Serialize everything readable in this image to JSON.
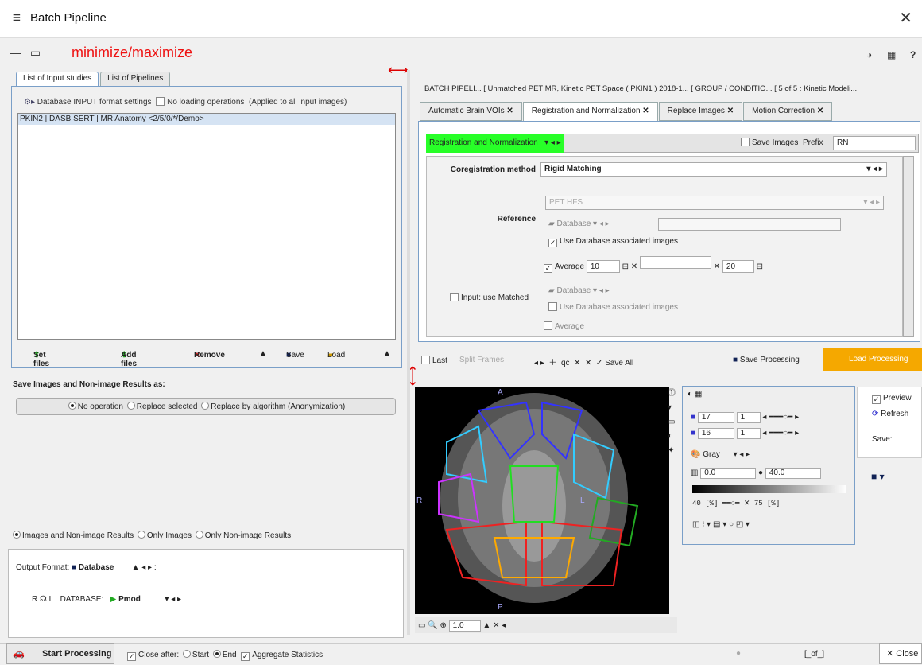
{
  "window": {
    "title": "Batch Pipeline",
    "annotation": "minimize/maximize"
  },
  "left": {
    "tabs": [
      "List of Input studies",
      "List of Pipelines"
    ],
    "db_settings": "Database INPUT format settings",
    "no_loading": "No loading operations",
    "applied_note": "(Applied to all input images)",
    "list_items": [
      "PKIN2 | DASB SERT | MR Anatomy <2/5/0/*/Demo>"
    ],
    "buttons": {
      "set_files": "Set files",
      "add_files": "Add files",
      "remove": "Remove",
      "save": "Save",
      "load": "Load"
    },
    "save_as_label": "Save Images and Non-image Results  as:",
    "save_options": [
      "No operation",
      "Replace selected",
      "Replace by algorithm (Anonymization)"
    ],
    "result_options": [
      "Images and Non-image Results",
      "Only Images",
      "Only Non-image Results"
    ],
    "output_format_label": "Output Format:",
    "output_format_value": "Database",
    "db_label": "DATABASE:",
    "db_value": "Pmod"
  },
  "right": {
    "breadcrumb": "BATCH PIPELI...  [ Unmatched PET MR, Kinetic PET Space ( PKIN1 ) 2018-1...  [ GROUP / CONDITIO...  [ 5 of 5 : Kinetic Modeli...",
    "tabs": [
      "Automatic Brain VOIs",
      "Registration and Normalization",
      "Replace Images",
      "Motion Correction"
    ],
    "step": "Registration and Normalization",
    "save_images": "Save Images",
    "prefix_label": "Prefix",
    "prefix_value": "RN",
    "coreg_label": "Coregistration method",
    "coreg_value": "Rigid Matching",
    "reference_label": "Reference",
    "ref_value": "PET HFS",
    "database": "Database",
    "use_db_assoc": "Use Database associated images",
    "average": "Average",
    "avg1": "10",
    "avg2": "20",
    "input_matched": "Input: use Matched",
    "last": "Last",
    "split_frames": "Split Frames",
    "qc": "qc",
    "save_all": "Save All",
    "save_processing": "Save Processing",
    "load_processing": "Load Processing"
  },
  "viewer": {
    "labels": {
      "a": "A",
      "p": "P",
      "r": "R",
      "l": "L"
    },
    "v17": "17",
    "v16": "16",
    "one1": "1",
    "one2": "1",
    "lut": "Gray",
    "min": "0.0",
    "max": "40.0",
    "pct_low": "40 [%]",
    "pct_high": "75 [%]",
    "preview": "Preview",
    "refresh": "Refresh",
    "save": "Save:",
    "zoom": "1.0"
  },
  "status": {
    "start": "Start Processing",
    "close_after": "Close after:",
    "start_opt": "Start",
    "end_opt": "End",
    "aggregate": "Aggregate Statistics",
    "page": "[_of_]",
    "close": "Close"
  }
}
